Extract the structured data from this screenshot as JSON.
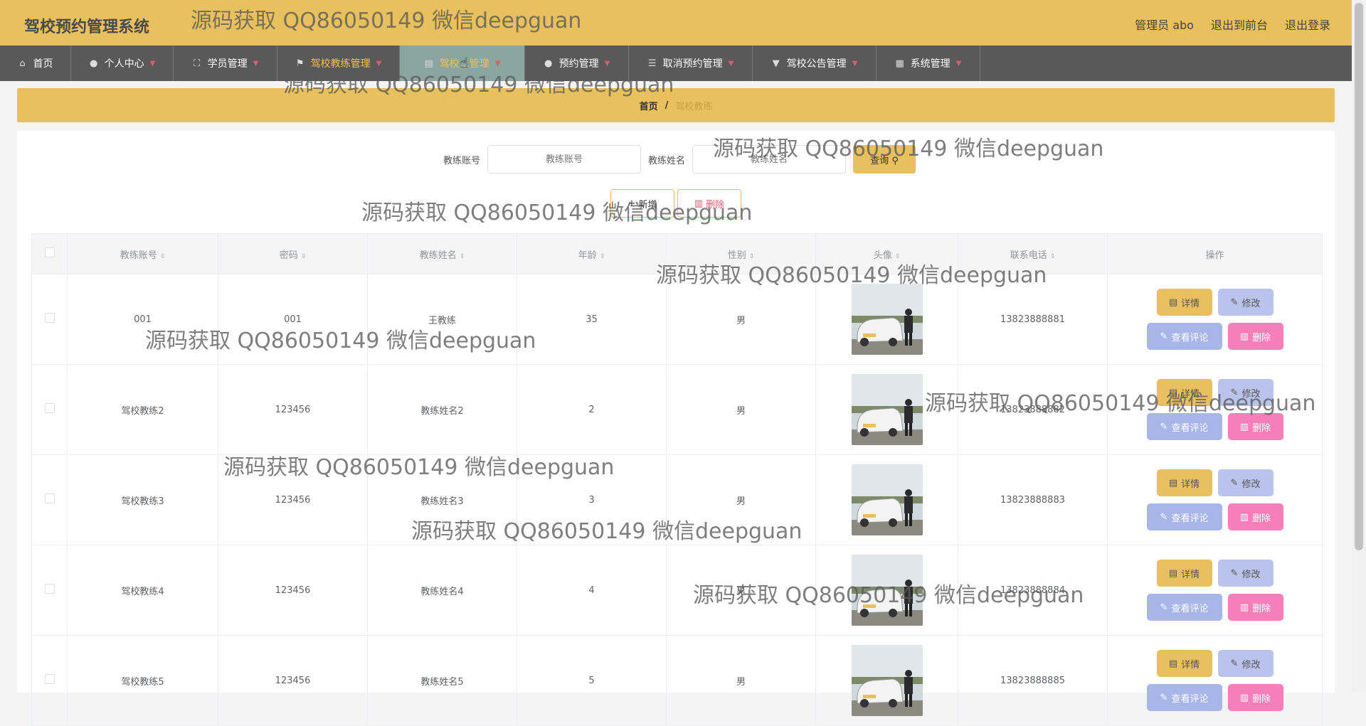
{
  "header": {
    "title": "驾校预约管理系统",
    "admin_label": "管理员 abo",
    "front_label": "退出到前台",
    "logout_label": "退出登录"
  },
  "nav": [
    {
      "label": "首页",
      "icon": "home-icon"
    },
    {
      "label": "个人中心",
      "icon": "user-icon"
    },
    {
      "label": "学员管理",
      "icon": "frame-icon"
    },
    {
      "label": "驾校教练管理",
      "icon": "flag-icon"
    },
    {
      "label": "驾校…管理",
      "icon": "doc-icon"
    },
    {
      "label": "预约管理",
      "icon": "circle-icon"
    },
    {
      "label": "取消预约管理",
      "icon": "sliders-icon"
    },
    {
      "label": "驾校公告管理",
      "icon": "pin-icon"
    },
    {
      "label": "系统管理",
      "icon": "chart-icon"
    }
  ],
  "breadcrumb": {
    "home": "首页",
    "sep": "/",
    "current": "驾校教练"
  },
  "search": {
    "account_label": "教练账号",
    "account_placeholder": "教练账号",
    "name_label": "教练姓名",
    "name_placeholder": "教练姓名",
    "query_label": "查询"
  },
  "actions": {
    "add_label": "新增",
    "delete_label": "删除"
  },
  "table": {
    "columns": [
      "教练账号",
      "密码",
      "教练姓名",
      "年龄",
      "性别",
      "头像",
      "联系电话",
      "操作"
    ],
    "rows": [
      {
        "account": "001",
        "password": "001",
        "name": "王教练",
        "age": "35",
        "gender": "男",
        "phone": "13823888881"
      },
      {
        "account": "驾校教练2",
        "password": "123456",
        "name": "教练姓名2",
        "age": "2",
        "gender": "男",
        "phone": "13823888882"
      },
      {
        "account": "驾校教练3",
        "password": "123456",
        "name": "教练姓名3",
        "age": "3",
        "gender": "男",
        "phone": "13823888883"
      },
      {
        "account": "驾校教练4",
        "password": "123456",
        "name": "教练姓名4",
        "age": "4",
        "gender": "男",
        "phone": "13823888884"
      },
      {
        "account": "驾校教练5",
        "password": "123456",
        "name": "教练姓名5",
        "age": "5",
        "gender": "男",
        "phone": "13823888885"
      }
    ],
    "op_labels": {
      "detail": "详情",
      "edit": "修改",
      "review": "查看评论",
      "delete": "删除"
    }
  },
  "watermark": "源码获取 QQ86050149 微信deepguan",
  "colors": {
    "accent": "#e8c15e",
    "nav_bg": "#595959",
    "delete_pink": "#f77fb9",
    "review_blue": "#a7b5e8"
  }
}
